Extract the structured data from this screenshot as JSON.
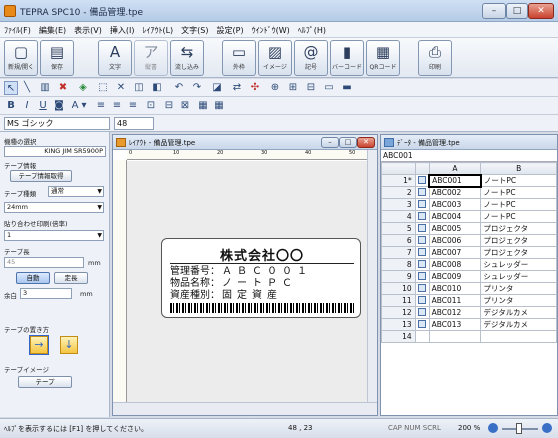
{
  "window": {
    "title": "TEPRA SPC10 - 備品管理.tpe",
    "min": "–",
    "max": "□",
    "close": "✕"
  },
  "menu": [
    "ﾌｧｲﾙ(F)",
    "編集(E)",
    "表示(V)",
    "挿入(I)",
    "ﾚｲｱｳﾄ(L)",
    "文字(S)",
    "設定(P)",
    "ｳｲﾝﾄﾞｳ(W)",
    "ﾍﾙﾌﾟ(H)"
  ],
  "ribbon": [
    {
      "label": "新規/開く",
      "icon": "▢",
      "name": "new-open-icon"
    },
    {
      "label": "保存",
      "icon": "▤",
      "name": "save-icon"
    },
    {
      "label": "文字",
      "icon": "A",
      "name": "text-icon"
    },
    {
      "label": "縦書",
      "icon": "ア",
      "name": "vertical-text-icon"
    },
    {
      "label": "流し込み",
      "icon": "⇆",
      "name": "flow-in-icon"
    },
    {
      "label": "外枠",
      "icon": "▭",
      "name": "frame-icon"
    },
    {
      "label": "イメージ",
      "icon": "▨",
      "name": "image-icon"
    },
    {
      "label": "記号",
      "icon": "@",
      "name": "symbol-icon"
    },
    {
      "label": "バーコード",
      "icon": "▮",
      "name": "barcode-icon"
    },
    {
      "label": "QRコード",
      "icon": "▦",
      "name": "qr-code-icon"
    },
    {
      "label": "印刷",
      "icon": "⎙",
      "name": "print-icon"
    }
  ],
  "toolbar2": [
    "↖",
    "╲",
    "▥",
    "✖",
    "◈",
    "⬚",
    "✕",
    "◫",
    "◧",
    "↶",
    "↷",
    "◪",
    "⇄",
    "✣",
    "⊕",
    "⊞",
    "⊟",
    "▭",
    "▬"
  ],
  "toolbar3": [
    "B",
    "I",
    "U",
    "◙",
    "A",
    "▾",
    "≡",
    "≡",
    "≡",
    "⊡",
    "⊟",
    "⊠",
    "▦",
    "▦"
  ],
  "font": {
    "name": "MS ゴシック",
    "size": "48"
  },
  "left_panel": {
    "model_label": "機種の選択",
    "model_value": "KING JIM SR5900P",
    "tape_info_label": "テープ情報",
    "tape_info_button": "テープ情報取得",
    "tape_type_label": "テープ種類",
    "tape_type_value": "通常",
    "tape_width_value": "24mm",
    "copies_label": "貼り合わせ印刷(倍率)",
    "copies_value": "1",
    "length_label": "テープ長",
    "length_value": "45",
    "length_unit": "mm",
    "auto_button": "自動",
    "fixed_button": "定長",
    "margin_label": "余白",
    "margin_value": "3",
    "margin_unit": "mm",
    "orientation_label": "テープの置き方",
    "preview_label": "テープイメージ",
    "preview_button": "テープ"
  },
  "layout_window": {
    "title": "ﾚｲｱｳﾄ - 備品管理.tpe",
    "ruler_marks": [
      "0",
      "10",
      "20",
      "30",
      "40",
      "50"
    ]
  },
  "tape_label": {
    "company": "株式会社〇〇",
    "rows": [
      {
        "key": "管理番号：",
        "val": "ＡＢＣ００１"
      },
      {
        "key": "物品名称：",
        "val": "ノートＰＣ"
      },
      {
        "key": "資産種別：",
        "val": "固定資産"
      }
    ]
  },
  "data_window": {
    "title": "ﾃﾞｰﾀ - 備品管理.tpe",
    "cell_ref": "ABC001",
    "col_a": "A",
    "col_b": "B",
    "rows": [
      {
        "n": "1*",
        "a": "ABC001",
        "b": "ノートPC"
      },
      {
        "n": "2",
        "a": "ABC002",
        "b": "ノートPC"
      },
      {
        "n": "3",
        "a": "ABC003",
        "b": "ノートPC"
      },
      {
        "n": "4",
        "a": "ABC004",
        "b": "ノートPC"
      },
      {
        "n": "5",
        "a": "ABC005",
        "b": "プロジェクタ"
      },
      {
        "n": "6",
        "a": "ABC006",
        "b": "プロジェクタ"
      },
      {
        "n": "7",
        "a": "ABC007",
        "b": "プロジェクタ"
      },
      {
        "n": "8",
        "a": "ABC008",
        "b": "シュレッダー"
      },
      {
        "n": "9",
        "a": "ABC009",
        "b": "シュレッダー"
      },
      {
        "n": "10",
        "a": "ABC010",
        "b": "プリンタ"
      },
      {
        "n": "11",
        "a": "ABC011",
        "b": "プリンタ"
      },
      {
        "n": "12",
        "a": "ABC012",
        "b": "デジタルカメ"
      },
      {
        "n": "13",
        "a": "ABC013",
        "b": "デジタルカメ"
      },
      {
        "n": "14",
        "a": "",
        "b": ""
      }
    ]
  },
  "status": {
    "help": "ﾍﾙﾌﾟを表示するには [F1] を押してください。",
    "coords": "48 , 23",
    "indicators": "CAP NUM SCRL",
    "zoom": "200 %"
  }
}
